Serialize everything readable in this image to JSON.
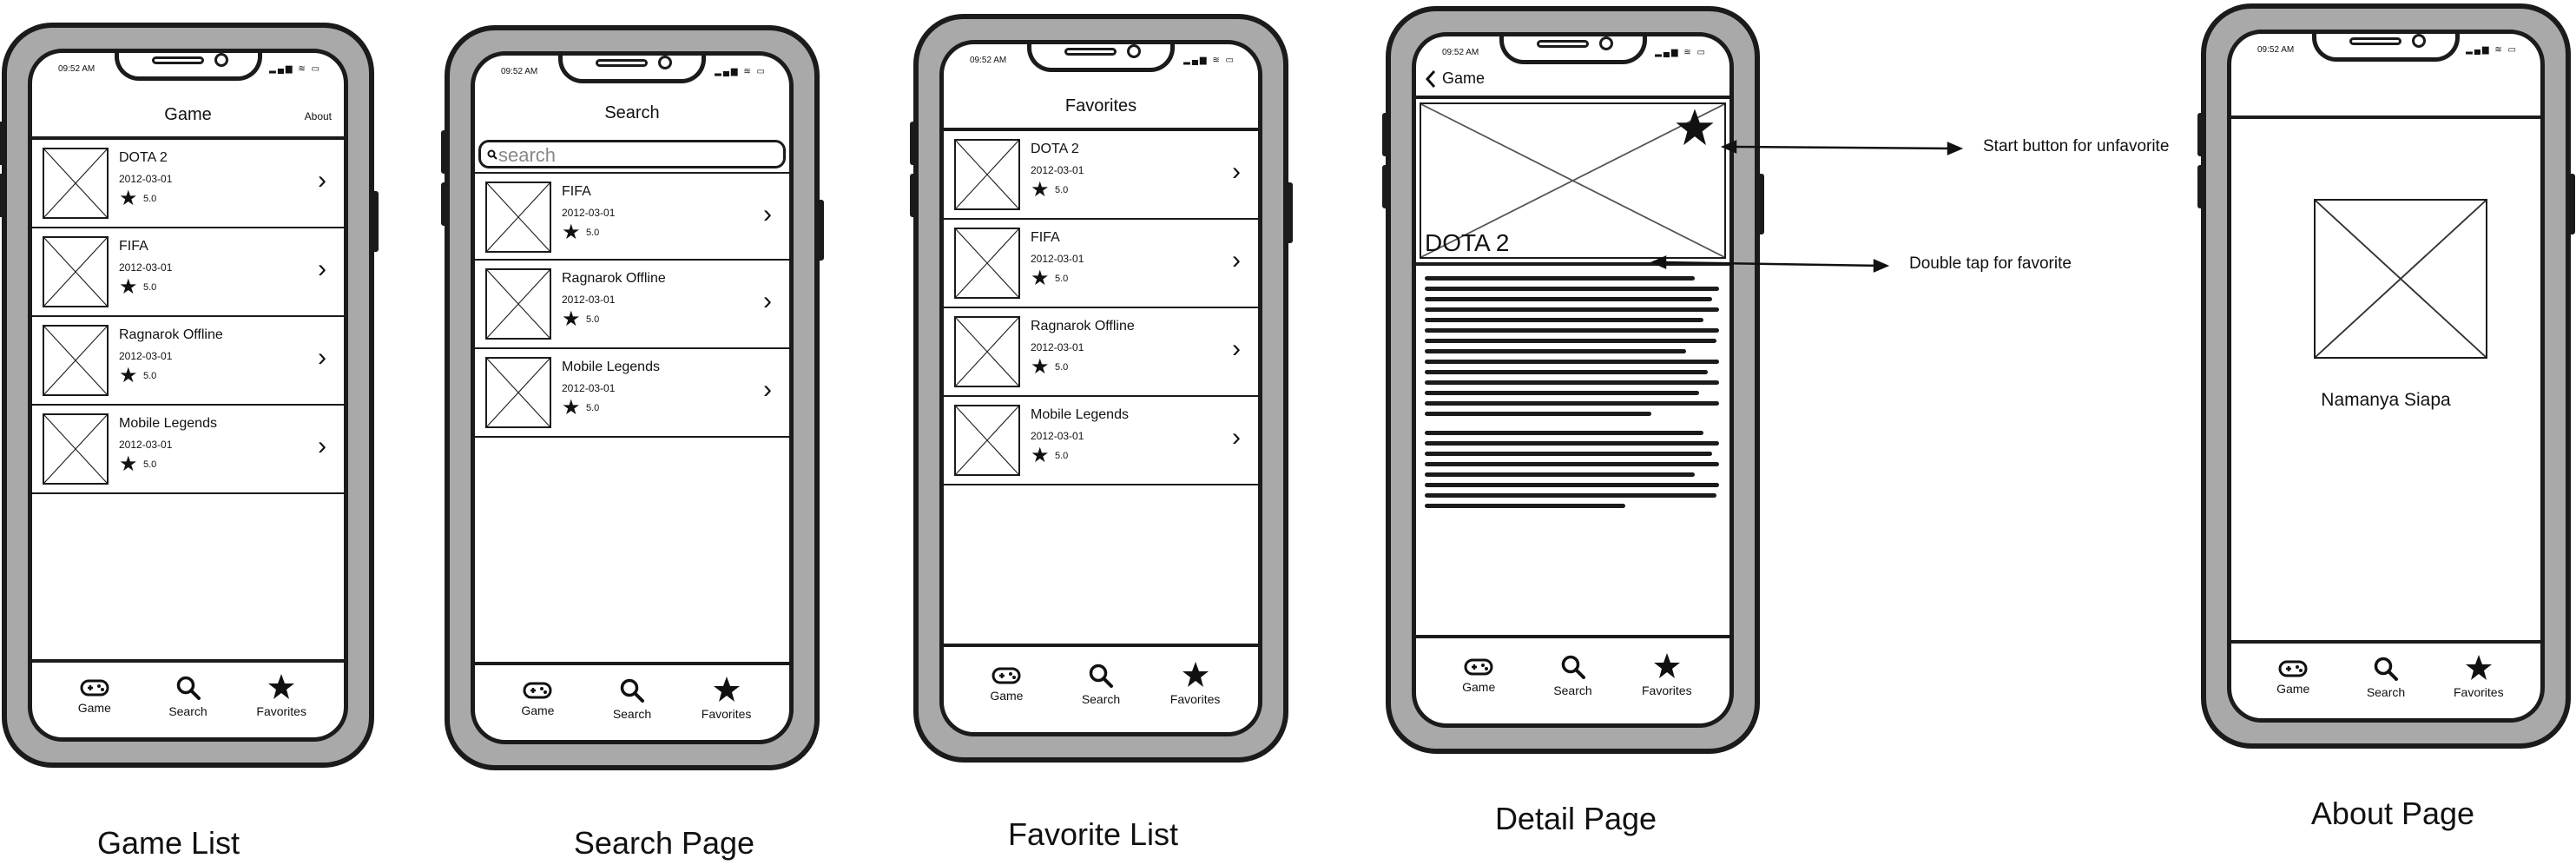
{
  "status": {
    "time": "09:52 AM",
    "icons": "▂▄▆ ≋ ▭"
  },
  "tabs": [
    {
      "label": "Game",
      "icon": "gamepad-icon"
    },
    {
      "label": "Search",
      "icon": "search-icon"
    },
    {
      "label": "Favorites",
      "icon": "star-icon"
    }
  ],
  "game_list": {
    "title": "Game",
    "about": "About",
    "caption": "Game List",
    "items": [
      {
        "name": "DOTA 2",
        "date": "2012-03-01",
        "rating": "5.0"
      },
      {
        "name": "FIFA",
        "date": "2012-03-01",
        "rating": "5.0"
      },
      {
        "name": "Ragnarok Offline",
        "date": "2012-03-01",
        "rating": "5.0"
      },
      {
        "name": "Mobile Legends",
        "date": "2012-03-01",
        "rating": "5.0"
      }
    ]
  },
  "search_page": {
    "title": "Search",
    "placeholder": "search",
    "caption": "Search Page",
    "items": [
      {
        "name": "FIFA",
        "date": "2012-03-01",
        "rating": "5.0"
      },
      {
        "name": "Ragnarok Offline",
        "date": "2012-03-01",
        "rating": "5.0"
      },
      {
        "name": "Mobile Legends",
        "date": "2012-03-01",
        "rating": "5.0"
      }
    ]
  },
  "favorite_list": {
    "title": "Favorites",
    "caption": "Favorite List",
    "items": [
      {
        "name": "DOTA 2",
        "date": "2012-03-01",
        "rating": "5.0"
      },
      {
        "name": "FIFA",
        "date": "2012-03-01",
        "rating": "5.0"
      },
      {
        "name": "Ragnarok Offline",
        "date": "2012-03-01",
        "rating": "5.0"
      },
      {
        "name": "Mobile Legends",
        "date": "2012-03-01",
        "rating": "5.0"
      }
    ]
  },
  "detail_page": {
    "back": "Game",
    "title": "DOTA 2",
    "caption": "Detail Page",
    "annotation_star": "Start button for unfavorite",
    "annotation_image": "Double tap for favorite"
  },
  "about_page": {
    "name": "Namanya Siapa",
    "caption": "About Page"
  }
}
